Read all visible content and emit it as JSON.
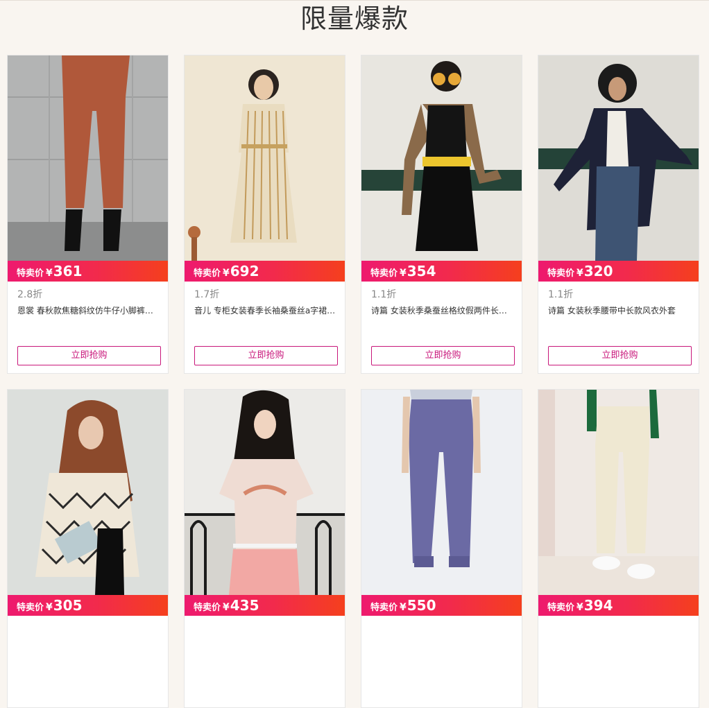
{
  "section": {
    "title": "限量爆款"
  },
  "price_label": "特卖价",
  "currency": "¥",
  "buy_label": "立即抢购",
  "colors": {
    "accent": "#c8167a",
    "price_bar_start": "#ee1a6e",
    "price_bar_end": "#f5401c"
  },
  "products": [
    {
      "price": "361",
      "discount": "2.8折",
      "name": "恩裳 春秋款焦糖斜纹仿牛仔小脚裤九分裤"
    },
    {
      "price": "692",
      "discount": "1.7折",
      "name": "音儿 专柜女装春季长袖桑蚕丝a字裙连衣裙"
    },
    {
      "price": "354",
      "discount": "1.1折",
      "name": "诗篇 女装秋季桑蚕丝格纹假两件长袖连衣裙"
    },
    {
      "price": "320",
      "discount": "1.1折",
      "name": "诗篇 女装秋季腰带中长款风衣外套"
    },
    {
      "price": "305",
      "discount": "",
      "name": ""
    },
    {
      "price": "435",
      "discount": "",
      "name": ""
    },
    {
      "price": "550",
      "discount": "",
      "name": ""
    },
    {
      "price": "394",
      "discount": "",
      "name": ""
    }
  ]
}
